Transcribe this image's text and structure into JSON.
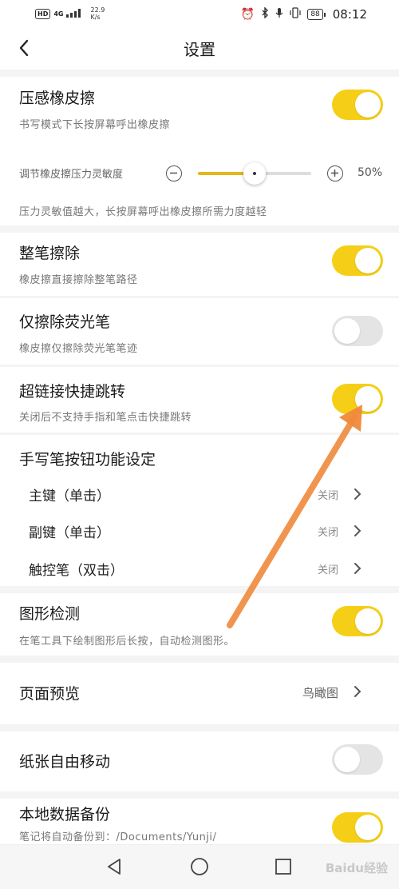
{
  "status_bar": {
    "hd": "HD",
    "network": "4G",
    "speed_value": "22.9",
    "speed_unit": "K/s",
    "battery": "88",
    "time": "08:12"
  },
  "header": {
    "title": "设置"
  },
  "eraser": {
    "title": "压感橡皮擦",
    "subtitle": "书写模式下长按屏幕呼出橡皮擦",
    "enabled": true,
    "sensitivity_label": "调节橡皮擦压力灵敏度",
    "sensitivity_value": "50%",
    "sensitivity_fraction": 0.5,
    "sensitivity_note": "压力灵敏值越大，长按屏幕呼出橡皮擦所需力度越轻"
  },
  "whole_stroke": {
    "title": "整笔擦除",
    "subtitle": "橡皮擦直接擦除整笔路径",
    "enabled": true
  },
  "highlighter_only": {
    "title": "仅擦除荧光笔",
    "subtitle": "橡皮擦仅擦除荧光笔笔迹",
    "enabled": false
  },
  "hyperlink": {
    "title": "超链接快捷跳转",
    "subtitle": "关闭后不支持手指和笔点击快捷跳转",
    "enabled": true
  },
  "pen_button": {
    "title": "手写笔按钮功能设定",
    "items": [
      {
        "label": "主键（单击）",
        "value": "关闭"
      },
      {
        "label": "副键（单击）",
        "value": "关闭"
      },
      {
        "label": "触控笔（双击）",
        "value": "关闭"
      }
    ]
  },
  "shape_detect": {
    "title": "图形检测",
    "subtitle": "在笔工具下绘制图形后长按，自动检测图形。",
    "enabled": true
  },
  "page_preview": {
    "title": "页面预览",
    "value": "鸟瞰图"
  },
  "paper_move": {
    "title": "纸张自由移动",
    "enabled": false
  },
  "backup": {
    "title": "本地数据备份",
    "subtitle": "笔记将自动备份到：/Documents/Yunji/",
    "enabled": true
  },
  "watermark": "Baidu经验",
  "colors": {
    "accent": "#f5cf17",
    "toggle_off": "#e4e4e4",
    "arrow": "#f0893a"
  }
}
